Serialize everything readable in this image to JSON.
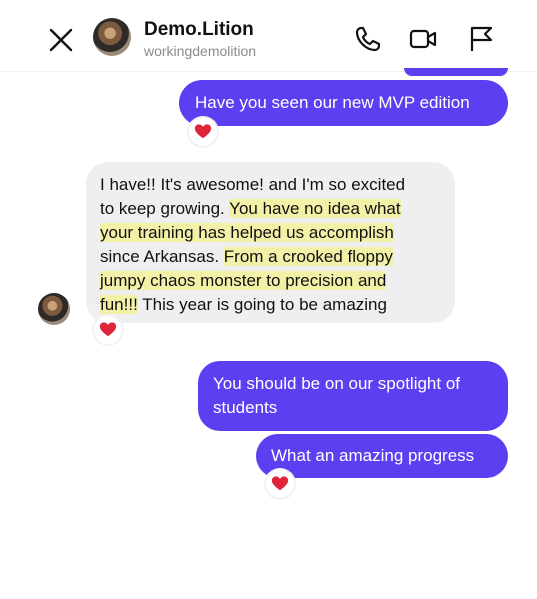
{
  "header": {
    "name": "Demo.Lition",
    "handle": "workingdemolition",
    "icons": [
      "close-icon",
      "phone-icon",
      "video-icon",
      "flag-icon"
    ]
  },
  "messages": [
    {
      "from": "me",
      "text": "Have you seen our new MVP edition",
      "reaction": "❤️"
    },
    {
      "from": "them",
      "lines": [
        [
          "I have!! It's awesome! and I'm so excited",
          ""
        ],
        [
          "to  keep growing. ",
          "You have no idea what"
        ],
        [
          "",
          "your training has helped us accomplish"
        ],
        [
          "since Arkansas. ",
          "From a crooked floppy"
        ],
        [
          "",
          "jumpy chaos monster to precision and"
        ],
        [
          "",
          "fun!!!",
          " This year is going to be amazing"
        ]
      ],
      "reaction": "❤️"
    },
    {
      "from": "me",
      "lines": [
        "You should be on our spotlight of",
        "students"
      ]
    },
    {
      "from": "me",
      "text": "What an amazing progress",
      "reaction": "❤️"
    }
  ],
  "colors": {
    "outgoing": "#5b3ff0",
    "incoming": "#efefef",
    "highlight": "#f3f0a8",
    "heart": "#e0243a"
  }
}
